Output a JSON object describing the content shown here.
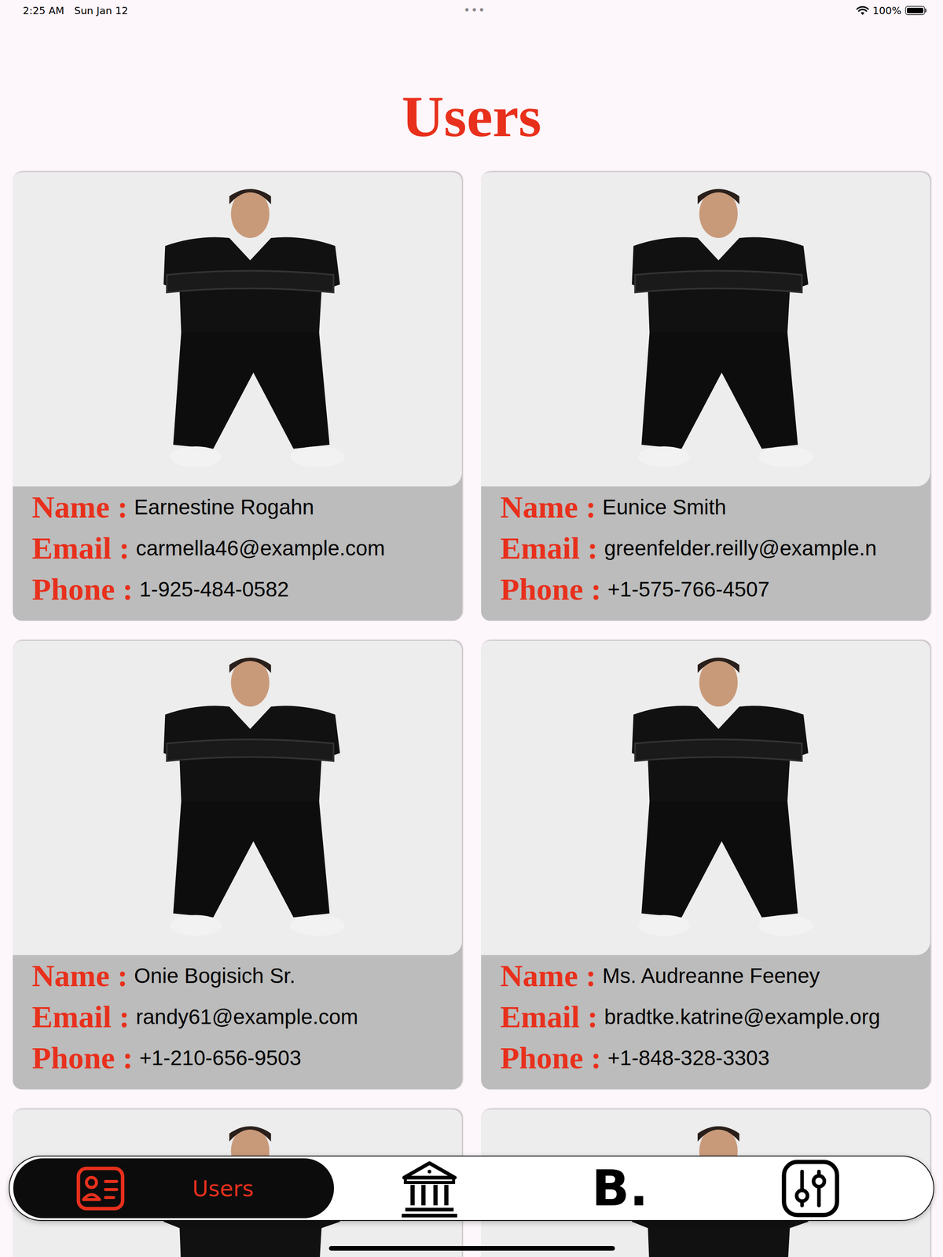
{
  "status_bar": {
    "time": "2:25 AM",
    "date": "Sun Jan 12",
    "dots": "•••",
    "battery": "100%",
    "battery_level": 1
  },
  "title": "Users",
  "field_labels": {
    "name": "Name :",
    "email": "Email :",
    "phone": "Phone :"
  },
  "users": [
    {
      "name": "Earnestine Rogahn",
      "email": "carmella46@example.com",
      "phone": "1-925-484-0582"
    },
    {
      "name": "Eunice Smith",
      "email": "greenfelder.reilly@example.n",
      "phone": "+1-575-766-4507"
    },
    {
      "name": "Onie Bogisich Sr.",
      "email": "randy61@example.com",
      "phone": "+1-210-656-9503"
    },
    {
      "name": "Ms. Audreanne Feeney",
      "email": "bradtke.katrine@example.org",
      "phone": "+1-848-328-3303"
    }
  ],
  "nav": [
    {
      "label": "Users",
      "selected": true
    },
    {
      "selected": false
    },
    {
      "glyph": "B.",
      "selected": false
    },
    {
      "selected": false
    }
  ]
}
